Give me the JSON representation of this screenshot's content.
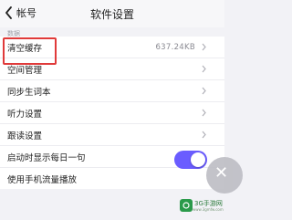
{
  "nav": {
    "back_label": "帐号",
    "title": "软件设置"
  },
  "section": {
    "label": "数据"
  },
  "rows": [
    {
      "label": "清空缓存",
      "value": "637.24KB"
    },
    {
      "label": "空间管理"
    },
    {
      "label": "同步生词本"
    },
    {
      "label": "听力设置"
    },
    {
      "label": "跟读设置"
    },
    {
      "label": "启动时显示每日一句",
      "toggle_on": true
    },
    {
      "label": "使用手机流量播放"
    }
  ],
  "colors": {
    "accent": "#6a5cff",
    "highlight": "#e03a3a"
  },
  "icons": {
    "back": "chevron-left-icon",
    "row_arrow": "chevron-right-icon"
  },
  "watermark": {
    "text": "3G手游网",
    "sub": "www.3gmfw.com"
  }
}
